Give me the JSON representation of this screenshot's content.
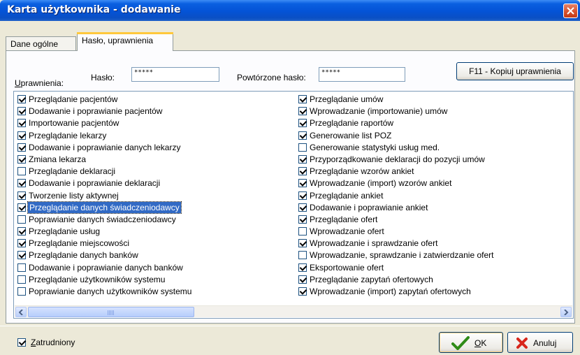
{
  "window": {
    "title": "Karta użytkownika - dodawanie"
  },
  "tabs": [
    {
      "label": "Dane ogólne"
    },
    {
      "label": "Hasło, uprawnienia"
    }
  ],
  "form": {
    "permissions_label": "Uprawnienia:",
    "password_label": "Hasło:",
    "password_value": "*****",
    "repeat_label": "Powtórzone hasło:",
    "repeat_value": "*****",
    "copy_button": "F11 - Kopiuj uprawnienia"
  },
  "permissions_left": [
    {
      "label": "Przeglądanie pacjentów",
      "checked": true
    },
    {
      "label": "Dodawanie i poprawianie pacjentów",
      "checked": true
    },
    {
      "label": "Importowanie pacjentów",
      "checked": true
    },
    {
      "label": "Przeglądanie lekarzy",
      "checked": true
    },
    {
      "label": "Dodawanie i poprawianie danych lekarzy",
      "checked": true
    },
    {
      "label": "Zmiana lekarza",
      "checked": true
    },
    {
      "label": "Przeglądanie deklaracji",
      "checked": false
    },
    {
      "label": "Dodawanie i poprawianie deklaracji",
      "checked": true
    },
    {
      "label": "Tworzenie listy aktywnej",
      "checked": true
    },
    {
      "label": "Przeglądanie danych świadczeniodawcy",
      "checked": true,
      "selected": true
    },
    {
      "label": "Poprawianie danych świadczeniodawcy",
      "checked": false
    },
    {
      "label": "Przeglądanie usług",
      "checked": true
    },
    {
      "label": "Przeglądanie miejscowości",
      "checked": true
    },
    {
      "label": "Przeglądanie danych banków",
      "checked": true
    },
    {
      "label": "Dodawanie i poprawianie danych banków",
      "checked": false
    },
    {
      "label": "Przeglądanie użytkowników systemu",
      "checked": false
    },
    {
      "label": "Poprawianie danych użytkowników systemu",
      "checked": false
    }
  ],
  "permissions_right": [
    {
      "label": "Przeglądanie umów",
      "checked": true
    },
    {
      "label": "Wprowadzanie (importowanie) umów",
      "checked": true
    },
    {
      "label": "Przeglądanie raportów",
      "checked": true
    },
    {
      "label": "Generowanie list POZ",
      "checked": true
    },
    {
      "label": "Generowanie statystyki usług med.",
      "checked": false
    },
    {
      "label": "Przyporządkowanie deklaracji do pozycji umów",
      "checked": true
    },
    {
      "label": "Przeglądanie wzorów ankiet",
      "checked": true
    },
    {
      "label": "Wprowadzanie (import) wzorów ankiet",
      "checked": true
    },
    {
      "label": "Przeglądanie ankiet",
      "checked": true
    },
    {
      "label": "Dodawanie i poprawianie ankiet",
      "checked": true
    },
    {
      "label": "Przeglądanie ofert",
      "checked": true
    },
    {
      "label": "Wprowadzanie ofert",
      "checked": false
    },
    {
      "label": "Wprowadzanie i sprawdzanie ofert",
      "checked": true
    },
    {
      "label": "Wprowadzanie, sprawdzanie i zatwierdzanie ofert",
      "checked": false
    },
    {
      "label": "Eksportowanie ofert",
      "checked": true
    },
    {
      "label": "Przeglądanie zapytań ofertowych",
      "checked": true
    },
    {
      "label": "Wprowadzanie (import) zapytań ofertowych",
      "checked": true
    }
  ],
  "employed": {
    "label": "Zatrudniony",
    "checked": true
  },
  "buttons": {
    "ok": "OK",
    "cancel": "Anuluj"
  },
  "colors": {
    "title_bar": "#0453d6",
    "selection": "#316ac5",
    "ok_icon": "#2e8b17",
    "cancel_icon": "#d8261c"
  }
}
